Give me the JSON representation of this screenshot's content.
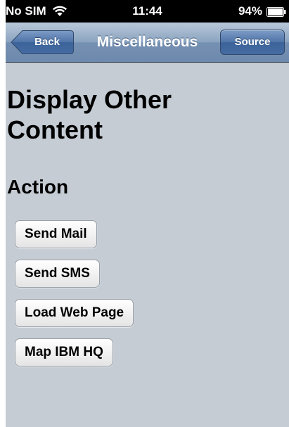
{
  "status_bar": {
    "carrier": "No SIM",
    "time": "11:44",
    "battery": "94%",
    "wifi_icon": "wifi-icon",
    "battery_icon": "battery-icon"
  },
  "nav": {
    "back_label": "Back",
    "title": "Miscellaneous",
    "source_label": "Source"
  },
  "content": {
    "title": "Display Other Content",
    "section": "Action",
    "buttons": [
      "Send Mail",
      "Send SMS",
      "Load Web Page",
      "Map IBM HQ"
    ]
  },
  "colors": {
    "background": "#c5ccd4",
    "nav_bar": "#7590b2",
    "status_bar": "#000000"
  }
}
